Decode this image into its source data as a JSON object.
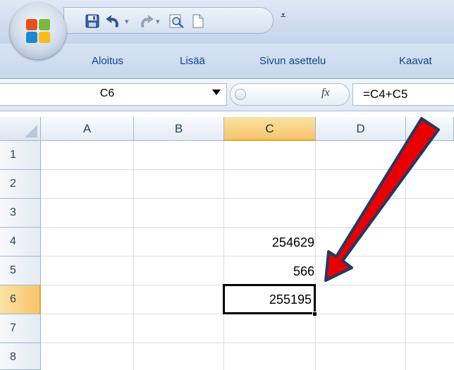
{
  "quick_access": {
    "icons": [
      "office-button-icon",
      "save-icon",
      "undo-icon",
      "redo-icon",
      "print-preview-icon",
      "new-document-icon",
      "customize-qat-icon"
    ]
  },
  "ribbon": {
    "tabs": [
      {
        "label": "Aloitus"
      },
      {
        "label": "Lisää"
      },
      {
        "label": "Sivun asettelu"
      },
      {
        "label": "Kaavat"
      }
    ]
  },
  "formula_bar": {
    "name_box": "C6",
    "fx": "fx",
    "formula": "=C4+C5"
  },
  "sheet": {
    "columns": [
      "A",
      "B",
      "C",
      "D",
      "E"
    ],
    "rows": [
      "1",
      "2",
      "3",
      "4",
      "5",
      "6",
      "7",
      "8"
    ],
    "selected_column": "C",
    "selected_row": "6",
    "cells": {
      "C4": "254629",
      "C5": "566",
      "C6": "255195"
    }
  },
  "colors": {
    "selection_header": "#f7c46b",
    "arrow_fill": "#e80000",
    "arrow_outline": "#1f3a66"
  }
}
